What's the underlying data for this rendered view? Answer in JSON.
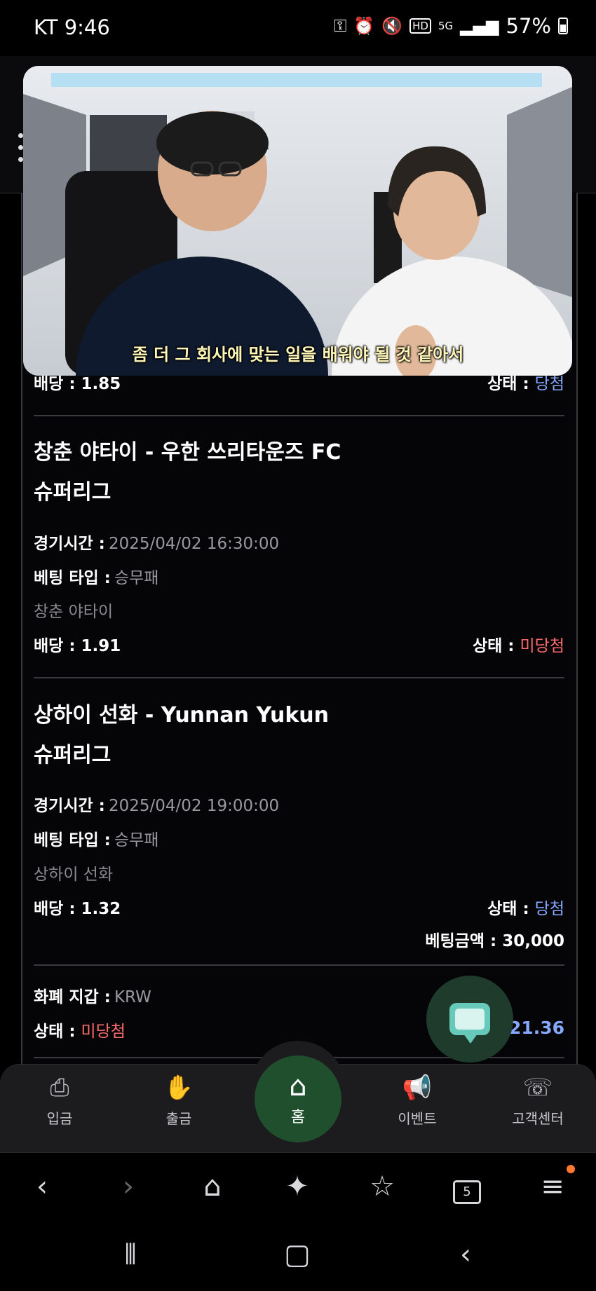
{
  "status_bar": {
    "carrier_time": "KT 9:46",
    "battery": "57%",
    "icons": [
      "key-icon",
      "alarm-icon",
      "mute-icon",
      "hd-icon",
      "5g-icon",
      "signal-icon",
      "battery-icon"
    ]
  },
  "video": {
    "subtitle": "좀 더 그 회사에 맞는 일을 배워야 될 것 같아서"
  },
  "partial_card": {
    "odds_label": "배당 :",
    "odds_value": "1.85",
    "status_label": "상태 :",
    "status_value": "당첨"
  },
  "bets": [
    {
      "match": "창춘 야타이 - 우한 쓰리타운즈 FC",
      "league": "슈퍼리그",
      "time_label": "경기시간 :",
      "time_value": "2025/04/02 16:30:00",
      "type_label": "베팅 타입 :",
      "type_value": "승무패",
      "pick": "창춘 야타이",
      "odds_label": "배당 :",
      "odds_value": "1.91",
      "status_label": "상태 :",
      "status_value": "미당첨"
    },
    {
      "match": "상하이 선화 - Yunnan Yukun",
      "league": "슈퍼리그",
      "time_label": "경기시간 :",
      "time_value": "2025/04/02 19:00:00",
      "type_label": "베팅 타입 :",
      "type_value": "승무패",
      "pick": "상하이 선화",
      "odds_label": "배당 :",
      "odds_value": "1.32",
      "status_label": "상태 :",
      "status_value": "당첨",
      "amount_label": "베팅금액 :",
      "amount_value": "30,000"
    }
  ],
  "summary": {
    "currency_label": "화폐 지갑 :",
    "currency_value": "KRW",
    "status_label": "상태 :",
    "status_value": "미당첨",
    "total_odds_value": ": 21.36"
  },
  "bottom_nav": {
    "items": [
      {
        "label": "입금",
        "icon": "deposit-icon"
      },
      {
        "label": "출금",
        "icon": "withdraw-icon"
      },
      {
        "label": "홈",
        "icon": "home-icon"
      },
      {
        "label": "이벤트",
        "icon": "megaphone-icon"
      },
      {
        "label": "고객센터",
        "icon": "support-24-icon"
      }
    ]
  },
  "browser_toolbar": {
    "tab_count": "5"
  },
  "colors": {
    "lost": "#ff6b6b",
    "won": "#86a8ff",
    "home_button": "#1f4f2d",
    "chat_fab": "#67c9b9"
  }
}
